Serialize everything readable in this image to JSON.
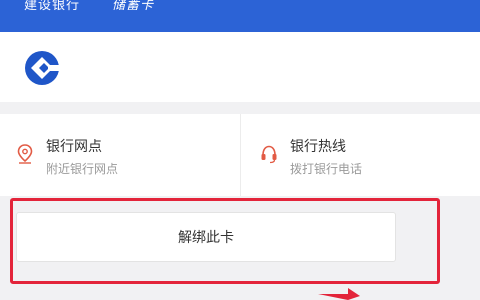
{
  "topbar": {
    "bank_name": "建设银行",
    "card_type": "储蓄卡"
  },
  "header": {
    "logo_icon": "ccb-logo-icon"
  },
  "services": [
    {
      "title": "银行网点",
      "subtitle": "附近银行网点",
      "icon": "location-pin-icon"
    },
    {
      "title": "银行热线",
      "subtitle": "拨打银行电话",
      "icon": "headset-icon"
    }
  ],
  "actions": {
    "unbind_label": "解绑此卡"
  },
  "colors": {
    "topbar": "#2c63d6",
    "logo": "#1f56c8",
    "service_icon": "#e25b45",
    "highlight": "#e3243a"
  }
}
